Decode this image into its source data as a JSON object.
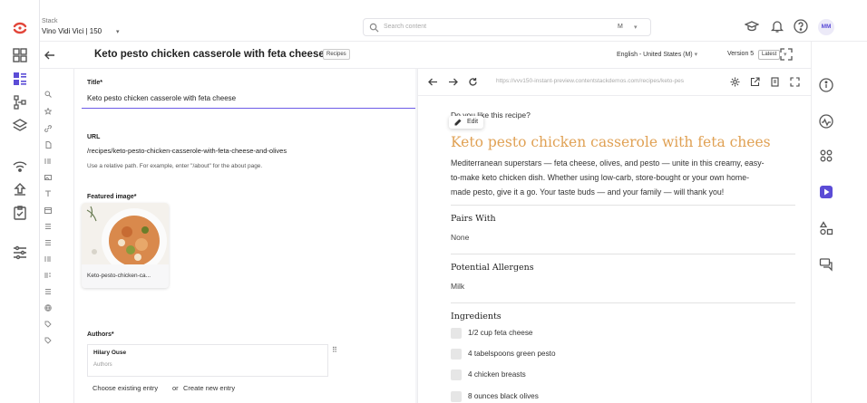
{
  "stack": {
    "label": "Stack",
    "name": "Vino Vidi Vici | 150"
  },
  "search": {
    "placeholder": "Search content",
    "mode": "M"
  },
  "user": {
    "initials": "MM"
  },
  "entry": {
    "title": "Keto pesto chicken casserole with feta cheese",
    "content_type": "Recipes",
    "locale": "English - United States (M)",
    "version": "Version 5",
    "version_badge": "Latest"
  },
  "form": {
    "title_label": "Title*",
    "title_value": "Keto pesto chicken casserole with feta cheese",
    "url_label": "URL",
    "url_value": "/recipes/keto-pesto-chicken-casserole-with-feta-cheese-and-olives",
    "url_help": "Use a relative path. For example, enter \"/about\" for the about page.",
    "image_label": "Featured image*",
    "image_caption": "Keto-pesto-chicken-ca...",
    "authors_label": "Authors*",
    "author_name": "Hilary Ouse",
    "author_type": "Authors",
    "choose_existing": "Choose existing entry",
    "or_text": "or",
    "create_new": "Create new entry"
  },
  "preview": {
    "url": "https://vvv150-instant-preview.contentstackdemos.com/recipes/keto-pes",
    "question": "Do you like this recipe?",
    "edit_label": "Edit",
    "title": "Keto pesto chicken casserole with feta chees",
    "description": "Mediterranean superstars — feta cheese, olives, and pesto — unite in this creamy, easy-to-make keto chicken dish. Whether using low-carb, store-bought or your own home-made pesto, give it a go. Your taste buds — and your family — will thank you!",
    "pairs_heading": "Pairs With",
    "pairs_value": "None",
    "allergens_heading": "Potential Allergens",
    "allergens_value": "Milk",
    "ingredients_heading": "Ingredients",
    "ingredients": [
      "1/2 cup feta cheese",
      "4 tabelspoons green pesto",
      "4 chicken breasts",
      "8 ounces black olives"
    ]
  },
  "colors": {
    "accent": "#5b4cd6",
    "preview_title": "#e0a154"
  }
}
